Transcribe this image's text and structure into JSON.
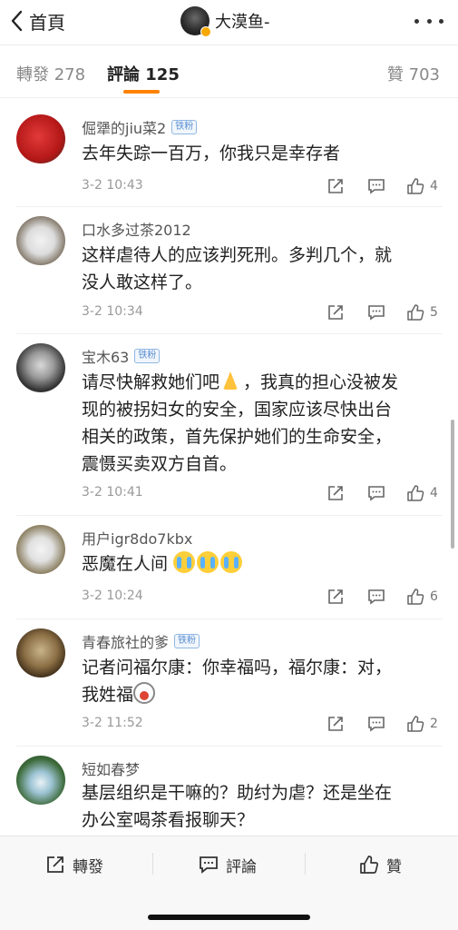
{
  "header": {
    "back_label": "首頁",
    "title": "大漠鱼-"
  },
  "tabs": {
    "repost": "轉發 278",
    "comments": "評論 125",
    "likes": "贊 703"
  },
  "badge_label": "铁粉",
  "comments": [
    {
      "name": "倔犟的jiu菜2",
      "has_badge": true,
      "text": [
        "去年失踪一百万，你我只是幸存者"
      ],
      "time": "3-2 10:43",
      "likes": "4"
    },
    {
      "name": "口水多过茶2012",
      "has_badge": false,
      "text": [
        "这样虐待人的应该判死刑。多判几个，就",
        "没人敢这样了。"
      ],
      "time": "3-2 10:34",
      "likes": "5"
    },
    {
      "name": "宝木63",
      "has_badge": true,
      "text": [
        "请尽快解救她们吧",
        "，我真的担心没被发",
        "现的被拐妇女的安全，国家应该尽快出台",
        "相关的政策，首先保护她们的生命安全，",
        "震慑买卖双方自首。"
      ],
      "time": "3-2 10:41",
      "likes": "4"
    },
    {
      "name": "用户igr8do7kbx",
      "has_badge": false,
      "text": [
        "恶魔在人间"
      ],
      "time": "3-2 10:24",
      "likes": "6"
    },
    {
      "name": "青春旅社的爹",
      "has_badge": true,
      "text": [
        "记者问福尔康：你幸福吗，福尔康：对，",
        "我姓福"
      ],
      "time": "3-2 11:52",
      "likes": "2"
    },
    {
      "name": "短如春梦",
      "has_badge": false,
      "text": [
        "基层组织是干嘛的？助纣为虐？还是坐在",
        "办公室喝茶看报聊天？"
      ],
      "time": "",
      "likes": ""
    }
  ],
  "bottom": {
    "repost": "轉發",
    "comment": "評論",
    "like": "贊"
  },
  "colors": {
    "accent": "#ff8200",
    "badge": "#5b8fd0"
  }
}
